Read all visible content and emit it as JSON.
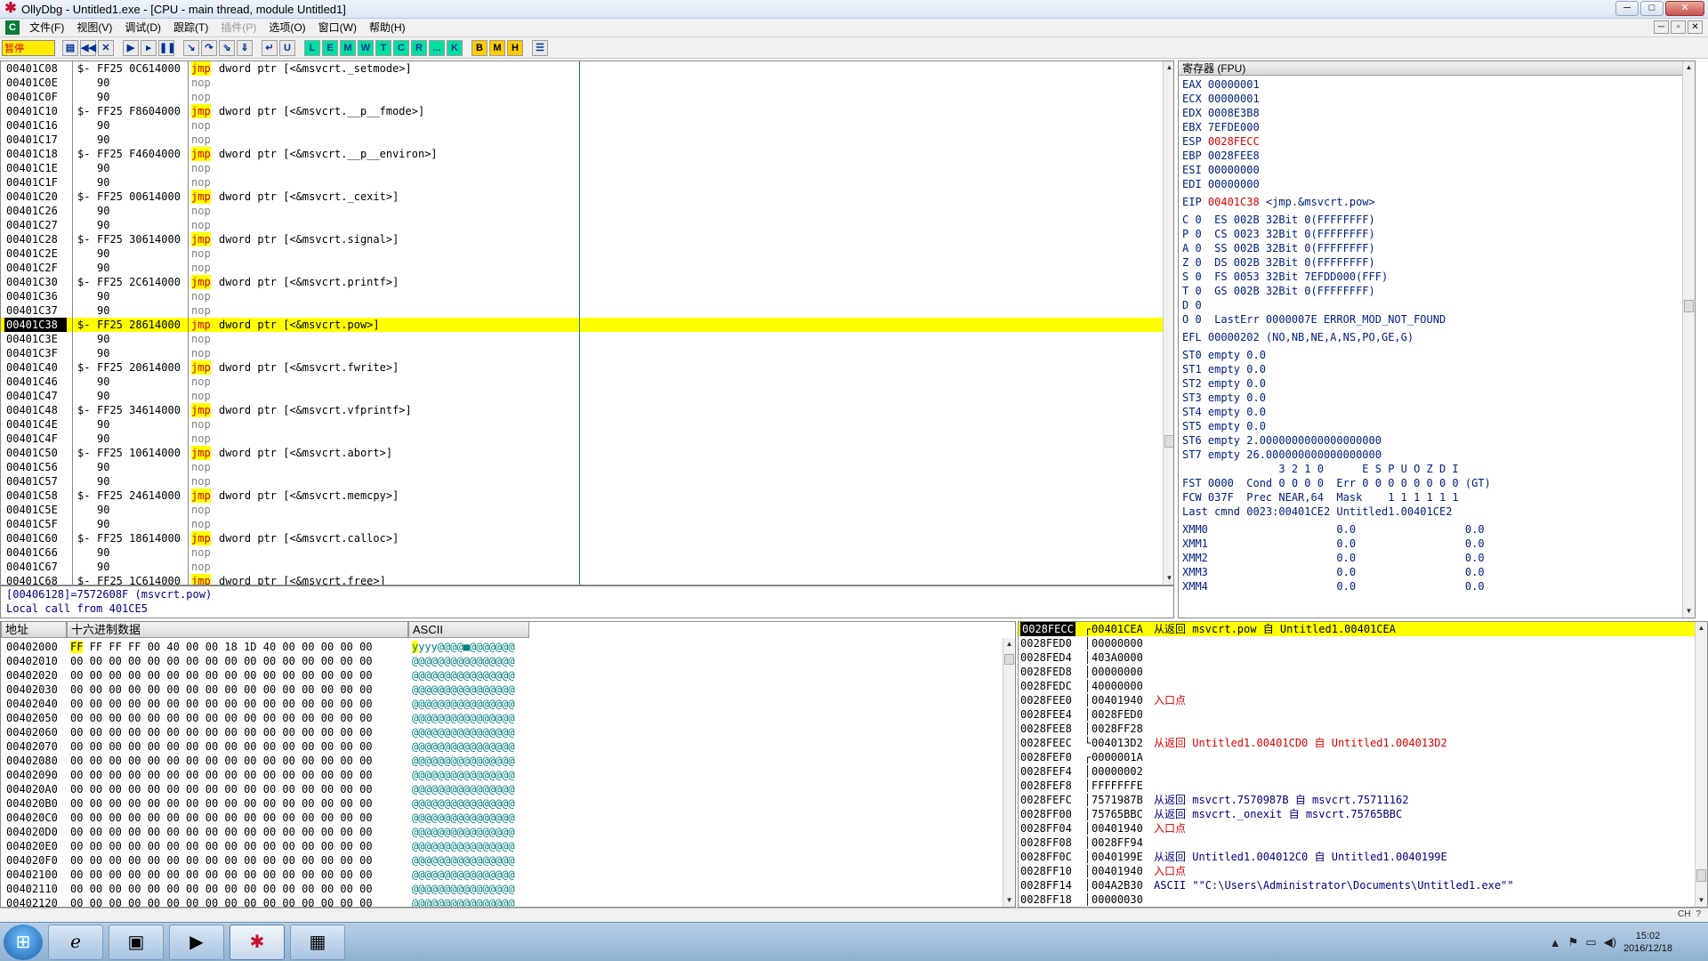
{
  "window": {
    "title": "OllyDbg - Untitled1.exe - [CPU - main thread, module Untitled1]",
    "app_icon": "bug-icon"
  },
  "menu": {
    "items": [
      {
        "label": "文件(F)",
        "enabled": true
      },
      {
        "label": "视图(V)",
        "enabled": true
      },
      {
        "label": "调试(D)",
        "enabled": true
      },
      {
        "label": "跟踪(T)",
        "enabled": true
      },
      {
        "label": "插件(P)",
        "enabled": false
      },
      {
        "label": "选项(O)",
        "enabled": true
      },
      {
        "label": "窗口(W)",
        "enabled": true
      },
      {
        "label": "帮助(H)",
        "enabled": true
      }
    ]
  },
  "toolbar": {
    "status": "暂停",
    "buttons": [
      "open",
      "restart",
      "close",
      "run",
      "step-into",
      "pause",
      "trace-into",
      "step-over",
      "animate-into",
      "animate-over",
      "execute-till-return",
      "goto-user",
      "L",
      "E",
      "M",
      "W",
      "T",
      "C",
      "R",
      "...",
      "K",
      "B",
      "M",
      "H",
      "list"
    ],
    "letter_labels": [
      "L",
      "E",
      "M",
      "W",
      "T",
      "C",
      "R",
      "...",
      "K",
      "B",
      "M",
      "H"
    ]
  },
  "disasm": {
    "rows": [
      {
        "addr": "00401C08",
        "br": "$-",
        "hex": "FF25 0C614000",
        "op": "jmp",
        "args": "dword ptr [<&msvcrt._setmode>]"
      },
      {
        "addr": "00401C0E",
        "br": "",
        "hex": "90",
        "op": "nop",
        "args": ""
      },
      {
        "addr": "00401C0F",
        "br": "",
        "hex": "90",
        "op": "nop",
        "args": ""
      },
      {
        "addr": "00401C10",
        "br": "$-",
        "hex": "FF25 F8604000",
        "op": "jmp",
        "args": "dword ptr [<&msvcrt.__p__fmode>]"
      },
      {
        "addr": "00401C16",
        "br": "",
        "hex": "90",
        "op": "nop",
        "args": ""
      },
      {
        "addr": "00401C17",
        "br": "",
        "hex": "90",
        "op": "nop",
        "args": ""
      },
      {
        "addr": "00401C18",
        "br": "$-",
        "hex": "FF25 F4604000",
        "op": "jmp",
        "args": "dword ptr [<&msvcrt.__p__environ>]"
      },
      {
        "addr": "00401C1E",
        "br": "",
        "hex": "90",
        "op": "nop",
        "args": ""
      },
      {
        "addr": "00401C1F",
        "br": "",
        "hex": "90",
        "op": "nop",
        "args": ""
      },
      {
        "addr": "00401C20",
        "br": "$-",
        "hex": "FF25 00614000",
        "op": "jmp",
        "args": "dword ptr [<&msvcrt._cexit>]"
      },
      {
        "addr": "00401C26",
        "br": "",
        "hex": "90",
        "op": "nop",
        "args": ""
      },
      {
        "addr": "00401C27",
        "br": "",
        "hex": "90",
        "op": "nop",
        "args": ""
      },
      {
        "addr": "00401C28",
        "br": "$-",
        "hex": "FF25 30614000",
        "op": "jmp",
        "args": "dword ptr [<&msvcrt.signal>]"
      },
      {
        "addr": "00401C2E",
        "br": "",
        "hex": "90",
        "op": "nop",
        "args": ""
      },
      {
        "addr": "00401C2F",
        "br": "",
        "hex": "90",
        "op": "nop",
        "args": ""
      },
      {
        "addr": "00401C30",
        "br": "$-",
        "hex": "FF25 2C614000",
        "op": "jmp",
        "args": "dword ptr [<&msvcrt.printf>]"
      },
      {
        "addr": "00401C36",
        "br": "",
        "hex": "90",
        "op": "nop",
        "args": ""
      },
      {
        "addr": "00401C37",
        "br": "",
        "hex": "90",
        "op": "nop",
        "args": ""
      },
      {
        "addr": "00401C38",
        "br": "$-",
        "hex": "FF25 28614000",
        "op": "jmp",
        "args": "dword ptr [<&msvcrt.pow>]",
        "current": true
      },
      {
        "addr": "00401C3E",
        "br": "",
        "hex": "90",
        "op": "nop",
        "args": ""
      },
      {
        "addr": "00401C3F",
        "br": "",
        "hex": "90",
        "op": "nop",
        "args": ""
      },
      {
        "addr": "00401C40",
        "br": "$-",
        "hex": "FF25 20614000",
        "op": "jmp",
        "args": "dword ptr [<&msvcrt.fwrite>]"
      },
      {
        "addr": "00401C46",
        "br": "",
        "hex": "90",
        "op": "nop",
        "args": ""
      },
      {
        "addr": "00401C47",
        "br": "",
        "hex": "90",
        "op": "nop",
        "args": ""
      },
      {
        "addr": "00401C48",
        "br": "$-",
        "hex": "FF25 34614000",
        "op": "jmp",
        "args": "dword ptr [<&msvcrt.vfprintf>]"
      },
      {
        "addr": "00401C4E",
        "br": "",
        "hex": "90",
        "op": "nop",
        "args": ""
      },
      {
        "addr": "00401C4F",
        "br": "",
        "hex": "90",
        "op": "nop",
        "args": ""
      },
      {
        "addr": "00401C50",
        "br": "$-",
        "hex": "FF25 10614000",
        "op": "jmp",
        "args": "dword ptr [<&msvcrt.abort>]"
      },
      {
        "addr": "00401C56",
        "br": "",
        "hex": "90",
        "op": "nop",
        "args": ""
      },
      {
        "addr": "00401C57",
        "br": "",
        "hex": "90",
        "op": "nop",
        "args": ""
      },
      {
        "addr": "00401C58",
        "br": "$-",
        "hex": "FF25 24614000",
        "op": "jmp",
        "args": "dword ptr [<&msvcrt.memcpy>]"
      },
      {
        "addr": "00401C5E",
        "br": "",
        "hex": "90",
        "op": "nop",
        "args": ""
      },
      {
        "addr": "00401C5F",
        "br": "",
        "hex": "90",
        "op": "nop",
        "args": ""
      },
      {
        "addr": "00401C60",
        "br": "$-",
        "hex": "FF25 18614000",
        "op": "jmp",
        "args": "dword ptr [<&msvcrt.calloc>]"
      },
      {
        "addr": "00401C66",
        "br": "",
        "hex": "90",
        "op": "nop",
        "args": ""
      },
      {
        "addr": "00401C67",
        "br": "",
        "hex": "90",
        "op": "nop",
        "args": ""
      },
      {
        "addr": "00401C68",
        "br": "$-",
        "hex": "FF25 1C614000",
        "op": "jmp",
        "args": "dword ptr [<&msvcrt.free>]"
      }
    ]
  },
  "info": {
    "line1": "[00406128]=7572608F (msvcrt.pow)",
    "line2": "Local call from 401CE5"
  },
  "registers": {
    "header": "寄存器 (FPU)",
    "lines": [
      {
        "text": "EAX 00000001"
      },
      {
        "text": "ECX 00000001"
      },
      {
        "text": "EDX 0008E3B8"
      },
      {
        "text": "EBX 7EFDE000"
      },
      {
        "name": "ESP ",
        "value": "0028FECC",
        "changed": true
      },
      {
        "text": "EBP 0028FEE8"
      },
      {
        "text": "ESI 00000000"
      },
      {
        "text": "EDI 00000000"
      },
      {
        "gap": true
      },
      {
        "name": "EIP ",
        "value": "00401C38",
        "changed": true,
        "tail": " <jmp.&msvcrt.pow>"
      },
      {
        "gap": true
      },
      {
        "text": "C 0  ES 002B 32Bit 0(FFFFFFFF)"
      },
      {
        "text": "P 0  CS 0023 32Bit 0(FFFFFFFF)"
      },
      {
        "text": "A 0  SS 002B 32Bit 0(FFFFFFFF)"
      },
      {
        "text": "Z 0  DS 002B 32Bit 0(FFFFFFFF)"
      },
      {
        "text": "S 0  FS 0053 32Bit 7EFDD000(FFF)"
      },
      {
        "text": "T 0  GS 002B 32Bit 0(FFFFFFFF)"
      },
      {
        "text": "D 0"
      },
      {
        "text": "O 0  LastErr 0000007E ERROR_MOD_NOT_FOUND"
      },
      {
        "gap": true
      },
      {
        "text": "EFL 00000202 (NO,NB,NE,A,NS,PO,GE,G)"
      },
      {
        "gap": true
      },
      {
        "text": "ST0 empty 0.0"
      },
      {
        "text": "ST1 empty 0.0"
      },
      {
        "text": "ST2 empty 0.0"
      },
      {
        "text": "ST3 empty 0.0"
      },
      {
        "text": "ST4 empty 0.0"
      },
      {
        "text": "ST5 empty 0.0"
      },
      {
        "text": "ST6 empty 2.0000000000000000000"
      },
      {
        "text": "ST7 empty 26.000000000000000000"
      },
      {
        "text": "               3 2 1 0      E S P U O Z D I"
      },
      {
        "text": "FST 0000  Cond 0 0 0 0  Err 0 0 0 0 0 0 0 0 (GT)"
      },
      {
        "text": "FCW 037F  Prec NEAR,64  Mask    1 1 1 1 1 1"
      },
      {
        "text": "Last cmnd 0023:00401CE2 Untitled1.00401CE2"
      },
      {
        "gap": true
      },
      {
        "text": "XMM0                    0.0                 0.0"
      },
      {
        "text": "XMM1                    0.0                 0.0"
      },
      {
        "text": "XMM2                    0.0                 0.0"
      },
      {
        "text": "XMM3                    0.0                 0.0"
      },
      {
        "text": "XMM4                    0.0                 0.0"
      }
    ]
  },
  "dump": {
    "col_addr": "地址",
    "col_hex": "十六进制数据",
    "col_ascii": "ASCII",
    "rows": [
      {
        "addr": "00402000",
        "first": "FF",
        "hex": "FF FF FF 00 40 00 00 18 1D 40 00 00 00 00 00",
        "ascii_first": "y",
        "ascii": "yyy@@@@■@@@@@@@"
      },
      {
        "addr": "00402010",
        "hex": "00 00 00 00 00 00 00 00 00 00 00 00 00 00 00 00",
        "ascii": "@@@@@@@@@@@@@@@@"
      },
      {
        "addr": "00402020",
        "hex": "00 00 00 00 00 00 00 00 00 00 00 00 00 00 00 00",
        "ascii": "@@@@@@@@@@@@@@@@"
      },
      {
        "addr": "00402030",
        "hex": "00 00 00 00 00 00 00 00 00 00 00 00 00 00 00 00",
        "ascii": "@@@@@@@@@@@@@@@@"
      },
      {
        "addr": "00402040",
        "hex": "00 00 00 00 00 00 00 00 00 00 00 00 00 00 00 00",
        "ascii": "@@@@@@@@@@@@@@@@"
      },
      {
        "addr": "00402050",
        "hex": "00 00 00 00 00 00 00 00 00 00 00 00 00 00 00 00",
        "ascii": "@@@@@@@@@@@@@@@@"
      },
      {
        "addr": "00402060",
        "hex": "00 00 00 00 00 00 00 00 00 00 00 00 00 00 00 00",
        "ascii": "@@@@@@@@@@@@@@@@"
      },
      {
        "addr": "00402070",
        "hex": "00 00 00 00 00 00 00 00 00 00 00 00 00 00 00 00",
        "ascii": "@@@@@@@@@@@@@@@@"
      },
      {
        "addr": "00402080",
        "hex": "00 00 00 00 00 00 00 00 00 00 00 00 00 00 00 00",
        "ascii": "@@@@@@@@@@@@@@@@"
      },
      {
        "addr": "00402090",
        "hex": "00 00 00 00 00 00 00 00 00 00 00 00 00 00 00 00",
        "ascii": "@@@@@@@@@@@@@@@@"
      },
      {
        "addr": "004020A0",
        "hex": "00 00 00 00 00 00 00 00 00 00 00 00 00 00 00 00",
        "ascii": "@@@@@@@@@@@@@@@@"
      },
      {
        "addr": "004020B0",
        "hex": "00 00 00 00 00 00 00 00 00 00 00 00 00 00 00 00",
        "ascii": "@@@@@@@@@@@@@@@@"
      },
      {
        "addr": "004020C0",
        "hex": "00 00 00 00 00 00 00 00 00 00 00 00 00 00 00 00",
        "ascii": "@@@@@@@@@@@@@@@@"
      },
      {
        "addr": "004020D0",
        "hex": "00 00 00 00 00 00 00 00 00 00 00 00 00 00 00 00",
        "ascii": "@@@@@@@@@@@@@@@@"
      },
      {
        "addr": "004020E0",
        "hex": "00 00 00 00 00 00 00 00 00 00 00 00 00 00 00 00",
        "ascii": "@@@@@@@@@@@@@@@@"
      },
      {
        "addr": "004020F0",
        "hex": "00 00 00 00 00 00 00 00 00 00 00 00 00 00 00 00",
        "ascii": "@@@@@@@@@@@@@@@@"
      },
      {
        "addr": "00402100",
        "hex": "00 00 00 00 00 00 00 00 00 00 00 00 00 00 00 00",
        "ascii": "@@@@@@@@@@@@@@@@"
      },
      {
        "addr": "00402110",
        "hex": "00 00 00 00 00 00 00 00 00 00 00 00 00 00 00 00",
        "ascii": "@@@@@@@@@@@@@@@@"
      },
      {
        "addr": "00402120",
        "hex": "00 00 00 00 00 00 00 00 00 00 00 00 00 00 00 00",
        "ascii": "@@@@@@@@@@@@@@@@"
      }
    ]
  },
  "stack": {
    "rows": [
      {
        "addr": "0028FECC",
        "br": "┌",
        "val": "00401CEA",
        "cmt": "从返回 msvcrt.pow 自 Untitled1.00401CEA",
        "kind": "red-black",
        "top": true
      },
      {
        "addr": "0028FED0",
        "br": "│",
        "val": "00000000",
        "cmt": ""
      },
      {
        "addr": "0028FED4",
        "br": "│",
        "val": "403A0000",
        "cmt": ""
      },
      {
        "addr": "0028FED8",
        "br": "│",
        "val": "00000000",
        "cmt": ""
      },
      {
        "addr": "0028FEDC",
        "br": "│",
        "val": "40000000",
        "cmt": ""
      },
      {
        "addr": "0028FEE0",
        "br": "│",
        "val": "00401940",
        "cmt": "入口点",
        "kind": "red"
      },
      {
        "addr": "0028FEE4",
        "br": "│",
        "val": "0028FED0",
        "cmt": ""
      },
      {
        "addr": "0028FEE8",
        "br": "│",
        "val": "0028FF28",
        "cmt": ""
      },
      {
        "addr": "0028FEEC",
        "br": "└",
        "val": "004013D2",
        "cmt": "从返回 Untitled1.00401CD0 自 Untitled1.004013D2",
        "kind": "red"
      },
      {
        "addr": "0028FEF0",
        "br": "┌",
        "val": "0000001A",
        "cmt": ""
      },
      {
        "addr": "0028FEF4",
        "br": "│",
        "val": "00000002",
        "cmt": ""
      },
      {
        "addr": "0028FEF8",
        "br": "│",
        "val": "FFFFFFFE",
        "cmt": ""
      },
      {
        "addr": "0028FEFC",
        "br": "│",
        "val": "7571987B",
        "cmt": "从返回 msvcrt.7570987B 自 msvcrt.75711162",
        "kind": "blue"
      },
      {
        "addr": "0028FF00",
        "br": "│",
        "val": "75765BBC",
        "cmt": "从返回 msvcrt._onexit 自 msvcrt.75765BBC",
        "kind": "blue"
      },
      {
        "addr": "0028FF04",
        "br": "│",
        "val": "00401940",
        "cmt": "入口点",
        "kind": "red"
      },
      {
        "addr": "0028FF08",
        "br": "│",
        "val": "0028FF94",
        "cmt": ""
      },
      {
        "addr": "0028FF0C",
        "br": "│",
        "val": "0040199E",
        "cmt": "从返回 Untitled1.004012C0 自 Untitled1.0040199E",
        "kind": "blue"
      },
      {
        "addr": "0028FF10",
        "br": "│",
        "val": "00401940",
        "cmt": "入口点",
        "kind": "red"
      },
      {
        "addr": "0028FF14",
        "br": "│",
        "val": "004A2B30",
        "cmt": "ASCII \"\"C:\\Users\\Administrator\\Documents\\Untitled1.exe\"\"",
        "kind": "blue"
      },
      {
        "addr": "0028FF18",
        "br": "│",
        "val": "00000030",
        "cmt": ""
      }
    ]
  },
  "taskbar": {
    "items": [
      "start-orb",
      "ie-icon",
      "explorer-icon",
      "media-player-icon",
      "ollydbg-icon",
      "window-icon"
    ],
    "lang": "CH",
    "time": "15:02",
    "date": "2016/12/18"
  },
  "colors": {
    "selection": "#ffff00",
    "changed_reg": "#e00000",
    "jmp_text": "#d00000",
    "ascii": "#008080"
  }
}
